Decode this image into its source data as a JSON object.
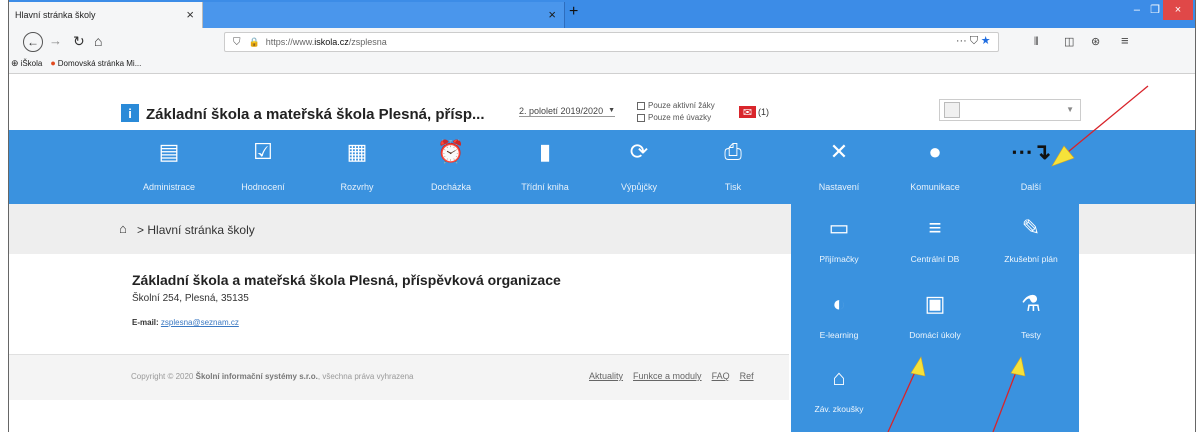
{
  "browser": {
    "tab_title": "Hlavní stránka školy",
    "tab_close": "×",
    "second_tab_close": "×",
    "new_tab": "+",
    "url_prefix": "https://www.",
    "url_domain": "iskola.cz",
    "url_path": "/zsplesna",
    "url_dots": "···",
    "bookmarks": [
      {
        "icon": "⊕",
        "label": "iŠkola"
      },
      {
        "icon": "●",
        "label": "Domovská stránka Mi..."
      }
    ],
    "window_min": "–",
    "window_max": "❐",
    "window_close": "×"
  },
  "header": {
    "logo_letter": "i",
    "school_name": "Základní škola a mateřská škola Plesná, přísp...",
    "semester": "2. pololetí 2019/2020",
    "checkbox_active": "Pouze aktivní žáky",
    "checkbox_mine": "Pouze mé úvazky",
    "mail_count": "(1)"
  },
  "menu": [
    {
      "label": "Administrace",
      "icon": "▤"
    },
    {
      "label": "Hodnocení",
      "icon": "☑"
    },
    {
      "label": "Rozvrhy",
      "icon": "▦"
    },
    {
      "label": "Docházka",
      "icon": "⏰"
    },
    {
      "label": "Třídní kniha",
      "icon": "▮"
    },
    {
      "label": "Výpůjčky",
      "icon": "⟳"
    },
    {
      "label": "Tisk",
      "icon": "⎙"
    },
    {
      "label": "Nastavení",
      "icon": "✕"
    },
    {
      "label": "Komunikace",
      "icon": "●"
    },
    {
      "label": "Další",
      "icon": "⋯↴"
    }
  ],
  "breadcrumb": {
    "separator": ">",
    "current": "Hlavní stránka školy"
  },
  "content": {
    "org_name": "Základní škola a mateřská škola Plesná, příspěvková organizace",
    "address": "Školní 254, Plesná, 35135",
    "email_label": "E-mail:",
    "email": "zsplesna@seznam.cz"
  },
  "footer": {
    "copyright_prefix": "Copyright © 2020",
    "company": "Školní informační systémy s.r.o.",
    "copyright_suffix": ", všechna práva vyhrazena",
    "links": [
      "Aktuality",
      "Funkce a moduly",
      "FAQ",
      "Ref"
    ]
  },
  "dropdown": [
    {
      "label": "Přijímačky",
      "icon": "▭"
    },
    {
      "label": "Centrální DB",
      "icon": "≡"
    },
    {
      "label": "Zkušební plán",
      "icon": "✎"
    },
    {
      "label": "E-learning",
      "icon": "◐"
    },
    {
      "label": "Domácí úkoly",
      "icon": "▣"
    },
    {
      "label": "Testy",
      "icon": "⚗"
    },
    {
      "label": "Záv. zkoušky",
      "icon": "⌂"
    }
  ],
  "colors": {
    "menu_blue": "#3a92df",
    "tab_blue": "#3c8ce7",
    "annotation_yellow": "#f6e23a",
    "annotation_red": "#d8232a"
  }
}
